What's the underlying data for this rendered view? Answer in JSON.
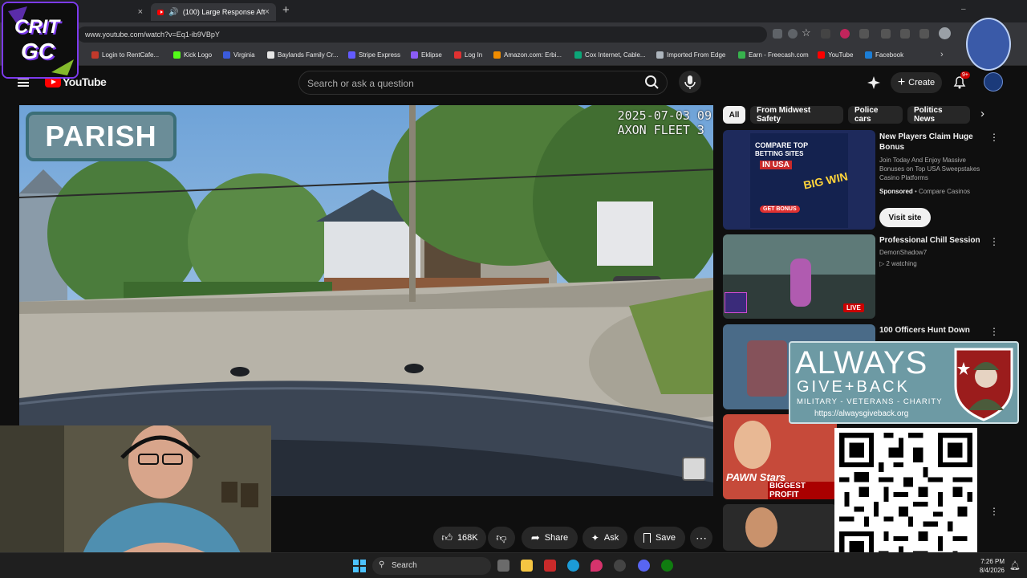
{
  "browser": {
    "tabs": [
      {
        "label": ""
      },
      {
        "label": "(100) Large Response After Ki"
      }
    ],
    "url": "www.youtube.com/watch?v=Eq1-ib9VBpY",
    "bookmarks": [
      {
        "label": "Login to RentCafe...",
        "color": "#c0392b"
      },
      {
        "label": "Kick Logo",
        "color": "#53fc18"
      },
      {
        "label": "Virginia",
        "color": "#3b5bdb"
      },
      {
        "label": "Baylands Family Cr...",
        "color": "#e6e6e6"
      },
      {
        "label": "Stripe Express",
        "color": "#635bff"
      },
      {
        "label": "Eklipse",
        "color": "#8b5cf6"
      },
      {
        "label": "Log In",
        "color": "#e03131"
      },
      {
        "label": "Amazon.com: Erbi...",
        "color": "#f08c00"
      },
      {
        "label": "Cox Internet, Cable...",
        "color": "#0ca678"
      },
      {
        "label": "Imported From Edge",
        "color": "#adb5bd"
      },
      {
        "label": "Earn - Freecash.com",
        "color": "#37b24d"
      },
      {
        "label": "YouTube",
        "color": "#ff0000"
      },
      {
        "label": "Facebook",
        "color": "#1c7ed6"
      }
    ]
  },
  "youtube": {
    "logo_text": "YouTube",
    "search_placeholder": "Search or ask a question",
    "create_label": "Create",
    "notification_count": "9+",
    "chips": [
      "All",
      "From Midwest Safety",
      "Police cars",
      "Politics News"
    ]
  },
  "video": {
    "badge": "PARISH",
    "timestamp_line1": "2025-07-03 09",
    "timestamp_line2": "AXON FLEET 3"
  },
  "actions": {
    "likes": "168K",
    "share": "Share",
    "ask": "Ask",
    "save": "Save"
  },
  "sidebar": {
    "ad": {
      "title": "New Players Claim Huge Bonus",
      "description": "Join Today And Enjoy Massive Bonuses on Top USA Sweepstakes Casino Platforms",
      "sponsored": "Sponsored",
      "advertiser": "Compare Casinos",
      "cta": "Visit site",
      "thumb_text1": "COMPARE TOP",
      "thumb_text2": "BETTING SITES",
      "thumb_text3": "IN USA",
      "thumb_text4": "BIG WIN",
      "thumb_text5": "GET BONUS"
    },
    "items": [
      {
        "title": "Professional Chill Session",
        "channel": "DemonShadow7",
        "meta": "2 watching",
        "badge": "LIVE"
      },
      {
        "title": "100 Officers Hunt Down",
        "channel": "",
        "meta": "",
        "badge": ""
      },
      {
        "title": "",
        "channel": "",
        "meta": "",
        "badge": "PAWN Stars",
        "thumb_caption": "BIGGEST PROFIT"
      }
    ]
  },
  "overlays": {
    "logo_line1": "CRIT",
    "logo_line2": "GC",
    "charity_line1": "ALWAYS",
    "charity_line2": "GIVE+BACK",
    "charity_tagline": "MILITARY - VETERANS - CHARITY",
    "charity_url": "https://alwaysgiveback.org"
  },
  "taskbar": {
    "search_label": "Search",
    "time": "7:26 PM",
    "date": "8/4/2026"
  }
}
